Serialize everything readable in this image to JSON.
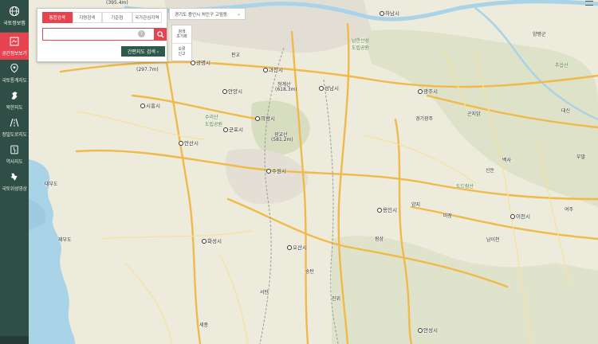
{
  "sidebar": {
    "logo_label": "국토정보맵",
    "items": [
      {
        "label": "공간정보보기",
        "icon": "layers-icon",
        "active": true
      },
      {
        "label": "국토통계지도",
        "icon": "map-pin-stats-icon",
        "active": false
      },
      {
        "label": "북한지도",
        "icon": "north-korea-map-icon",
        "active": false
      },
      {
        "label": "정밀도로지도",
        "icon": "road-icon",
        "active": false
      },
      {
        "label": "역사지도",
        "icon": "history-map-icon",
        "active": false
      },
      {
        "label": "국토위성영상",
        "icon": "satellite-icon",
        "active": false
      }
    ],
    "active_color": "#e7424f",
    "bg_color": "#2f4e45"
  },
  "search": {
    "tabs": [
      "통합검색",
      "지명검색",
      "기준점",
      "국가관심지역"
    ],
    "input_value": "",
    "help_glyph": "?",
    "simple_map_button": "간편지도 검색  ›"
  },
  "tools": {
    "reset": "검색\n초기화",
    "report": "오류\n신고"
  },
  "location": {
    "text": "경기도 용인시 처인구 고림동",
    "chevron": "⌄"
  },
  "map_labels": [
    {
      "text": "(395.4m)",
      "kind": "plain"
    },
    {
      "text": "(297.7m)",
      "kind": "plain"
    },
    {
      "text": "광명시",
      "kind": "city"
    },
    {
      "text": "판교",
      "kind": "plain"
    },
    {
      "text": "과천시",
      "kind": "city"
    },
    {
      "text": "청계산",
      "kind": "plain"
    },
    {
      "text": "(618.3m)",
      "kind": "plain"
    },
    {
      "text": "하남시",
      "kind": "city"
    },
    {
      "text": "남한산성\n도립공원",
      "kind": "plain"
    },
    {
      "text": "성남시",
      "kind": "city"
    },
    {
      "text": "광주시",
      "kind": "city"
    },
    {
      "text": "안양시",
      "kind": "city"
    },
    {
      "text": "시흥시",
      "kind": "city"
    },
    {
      "text": "의왕시",
      "kind": "city"
    },
    {
      "text": "광교산",
      "kind": "plain"
    },
    {
      "text": "(581.2m)",
      "kind": "plain"
    },
    {
      "text": "군포시",
      "kind": "city"
    },
    {
      "text": "수리산\n도립공원",
      "kind": "plain"
    },
    {
      "text": "안산시",
      "kind": "city"
    },
    {
      "text": "수원시",
      "kind": "city"
    },
    {
      "text": "용인시",
      "kind": "city"
    },
    {
      "text": "도드람산",
      "kind": "plain"
    },
    {
      "text": "이천시",
      "kind": "city"
    },
    {
      "text": "화성시",
      "kind": "city"
    },
    {
      "text": "오산시",
      "kind": "city"
    },
    {
      "text": "대부도",
      "kind": "plain"
    },
    {
      "text": "제부도",
      "kind": "plain"
    },
    {
      "text": "안성시",
      "kind": "city"
    },
    {
      "text": "경기광주",
      "kind": "plain"
    },
    {
      "text": "곤지암",
      "kind": "plain"
    },
    {
      "text": "양평군",
      "kind": "plain"
    },
    {
      "text": "추읍산",
      "kind": "plain"
    },
    {
      "text": "대신",
      "kind": "plain"
    },
    {
      "text": "여주",
      "kind": "plain"
    },
    {
      "text": "부발",
      "kind": "plain"
    },
    {
      "text": "백사",
      "kind": "plain"
    },
    {
      "text": "신둔",
      "kind": "plain"
    },
    {
      "text": "마장",
      "kind": "plain"
    },
    {
      "text": "남이천",
      "kind": "plain"
    },
    {
      "text": "양지",
      "kind": "plain"
    },
    {
      "text": "원삼",
      "kind": "plain"
    },
    {
      "text": "진위",
      "kind": "plain"
    },
    {
      "text": "송탄",
      "kind": "plain"
    },
    {
      "text": "서탄",
      "kind": "plain"
    },
    {
      "text": "세종",
      "kind": "plain"
    }
  ],
  "colors": {
    "water": "#a9d3e6",
    "land": "#ecebdc",
    "forest": "#d9dfc4",
    "highway": "#f1b94a",
    "road": "#f7e29b",
    "urban": "#e5e0d6"
  }
}
